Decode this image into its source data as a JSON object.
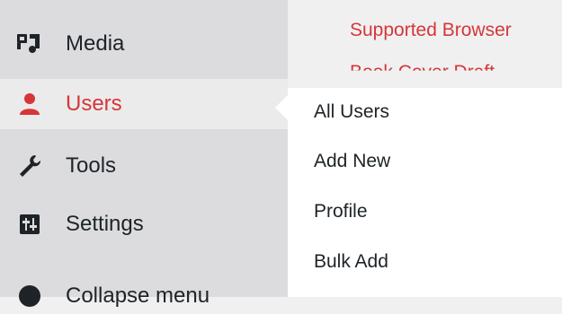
{
  "content": {
    "links": [
      "Supported Browser",
      "Book Cover Draft"
    ]
  },
  "sidebar": {
    "items": [
      {
        "label": "Media",
        "icon": "media-icon"
      },
      {
        "label": "Users",
        "icon": "users-icon",
        "active": true
      },
      {
        "label": "Tools",
        "icon": "wrench-icon"
      },
      {
        "label": "Settings",
        "icon": "settings-icon"
      },
      {
        "label": "Collapse menu",
        "icon": "collapse-icon"
      }
    ]
  },
  "users_submenu": {
    "items": [
      "All Users",
      "Add New",
      "Profile",
      "Bulk Add"
    ]
  },
  "colors": {
    "accent": "#d63638",
    "sidebar_bg": "#dcdcde",
    "active_bg": "#ebebeb",
    "text": "#1d2327"
  }
}
